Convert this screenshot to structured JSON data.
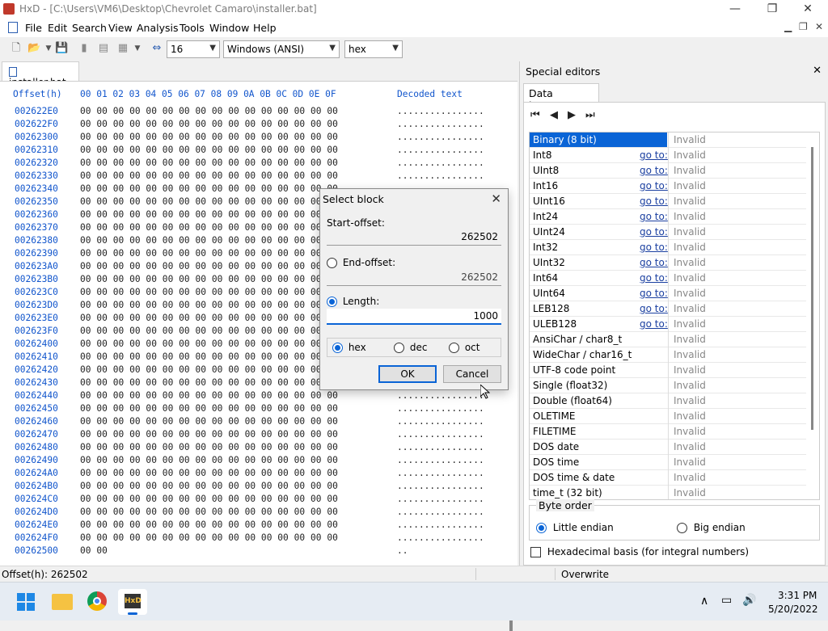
{
  "window": {
    "title": "HxD - [C:\\Users\\VM6\\Desktop\\Chevrolet Camaro\\installer.bat]",
    "minimize": "—",
    "maximize": "❐",
    "close": "✕"
  },
  "menu": [
    "File",
    "Edit",
    "Search",
    "View",
    "Analysis",
    "Tools",
    "Window",
    "Help"
  ],
  "toolbar": {
    "bytes_per_row": "16",
    "charset": "Windows (ANSI)",
    "display_mode": "hex"
  },
  "editor": {
    "tab": "installer.bat",
    "header_offset": "Offset(h)",
    "header_bytes": "00 01 02 03 04 05 06 07 08 09 0A 0B 0C 0D 0E 0F",
    "header_decoded": "Decoded text",
    "rows": [
      {
        "o": "002622E0",
        "h": "00 00 00 00 00 00 00 00 00 00 00 00 00 00 00 00",
        "d": "................"
      },
      {
        "o": "002622F0",
        "h": "00 00 00 00 00 00 00 00 00 00 00 00 00 00 00 00",
        "d": "................"
      },
      {
        "o": "00262300",
        "h": "00 00 00 00 00 00 00 00 00 00 00 00 00 00 00 00",
        "d": "................"
      },
      {
        "o": "00262310",
        "h": "00 00 00 00 00 00 00 00 00 00 00 00 00 00 00 00",
        "d": "................"
      },
      {
        "o": "00262320",
        "h": "00 00 00 00 00 00 00 00 00 00 00 00 00 00 00 00",
        "d": "................"
      },
      {
        "o": "00262330",
        "h": "00 00 00 00 00 00 00 00 00 00 00 00 00 00 00 00",
        "d": "................"
      },
      {
        "o": "00262340",
        "h": "00 00 00 00 00 00 00 00 00 00 00 00 00 00 00 00",
        "d": "................"
      },
      {
        "o": "00262350",
        "h": "00 00 00 00 00 00 00 00 00 00 00 00 00 00 00 00",
        "d": "................"
      },
      {
        "o": "00262360",
        "h": "00 00 00 00 00 00 00 00 00 00 00 00 00 00 00 00",
        "d": "................"
      },
      {
        "o": "00262370",
        "h": "00 00 00 00 00 00 00 00 00 00 00 00 00 00 00 00",
        "d": "................"
      },
      {
        "o": "00262380",
        "h": "00 00 00 00 00 00 00 00 00 00 00 00 00 00 00 00",
        "d": "................"
      },
      {
        "o": "00262390",
        "h": "00 00 00 00 00 00 00 00 00 00 00 00 00 00 00 00",
        "d": "................"
      },
      {
        "o": "002623A0",
        "h": "00 00 00 00 00 00 00 00 00 00 00 00 00 00 00 00",
        "d": "................"
      },
      {
        "o": "002623B0",
        "h": "00 00 00 00 00 00 00 00 00 00 00 00 00 00 00 00",
        "d": "................"
      },
      {
        "o": "002623C0",
        "h": "00 00 00 00 00 00 00 00 00 00 00 00 00 00 00 00",
        "d": "................"
      },
      {
        "o": "002623D0",
        "h": "00 00 00 00 00 00 00 00 00 00 00 00 00 00 00 00",
        "d": "................"
      },
      {
        "o": "002623E0",
        "h": "00 00 00 00 00 00 00 00 00 00 00 00 00 00 00 00",
        "d": "................"
      },
      {
        "o": "002623F0",
        "h": "00 00 00 00 00 00 00 00 00 00 00 00 00 00 00 00",
        "d": "................"
      },
      {
        "o": "00262400",
        "h": "00 00 00 00 00 00 00 00 00 00 00 00 00 00 00 00",
        "d": "................"
      },
      {
        "o": "00262410",
        "h": "00 00 00 00 00 00 00 00 00 00 00 00 00 00 00 00",
        "d": "................"
      },
      {
        "o": "00262420",
        "h": "00 00 00 00 00 00 00 00 00 00 00 00 00 00 00 00",
        "d": "................"
      },
      {
        "o": "00262430",
        "h": "00 00 00 00 00 00 00 00 00 00 00 00 00 00 00 00",
        "d": "................"
      },
      {
        "o": "00262440",
        "h": "00 00 00 00 00 00 00 00 00 00 00 00 00 00 00 00",
        "d": "................"
      },
      {
        "o": "00262450",
        "h": "00 00 00 00 00 00 00 00 00 00 00 00 00 00 00 00",
        "d": "................"
      },
      {
        "o": "00262460",
        "h": "00 00 00 00 00 00 00 00 00 00 00 00 00 00 00 00",
        "d": "................"
      },
      {
        "o": "00262470",
        "h": "00 00 00 00 00 00 00 00 00 00 00 00 00 00 00 00",
        "d": "................"
      },
      {
        "o": "00262480",
        "h": "00 00 00 00 00 00 00 00 00 00 00 00 00 00 00 00",
        "d": "................"
      },
      {
        "o": "00262490",
        "h": "00 00 00 00 00 00 00 00 00 00 00 00 00 00 00 00",
        "d": "................"
      },
      {
        "o": "002624A0",
        "h": "00 00 00 00 00 00 00 00 00 00 00 00 00 00 00 00",
        "d": "................"
      },
      {
        "o": "002624B0",
        "h": "00 00 00 00 00 00 00 00 00 00 00 00 00 00 00 00",
        "d": "................"
      },
      {
        "o": "002624C0",
        "h": "00 00 00 00 00 00 00 00 00 00 00 00 00 00 00 00",
        "d": "................"
      },
      {
        "o": "002624D0",
        "h": "00 00 00 00 00 00 00 00 00 00 00 00 00 00 00 00",
        "d": "................"
      },
      {
        "o": "002624E0",
        "h": "00 00 00 00 00 00 00 00 00 00 00 00 00 00 00 00",
        "d": "................"
      },
      {
        "o": "002624F0",
        "h": "00 00 00 00 00 00 00 00 00 00 00 00 00 00 00 00",
        "d": "................"
      },
      {
        "o": "00262500",
        "h": "00 00",
        "d": ".."
      }
    ]
  },
  "special": {
    "title": "Special editors",
    "close": "✕",
    "inspector_tab": "Data inspector",
    "nav": [
      "⏮",
      "◀",
      "▶",
      "⏭"
    ],
    "rows": [
      {
        "name": "Binary (8 bit)",
        "goto": "",
        "value": "Invalid"
      },
      {
        "name": "Int8",
        "goto": "go to:",
        "value": "Invalid"
      },
      {
        "name": "UInt8",
        "goto": "go to:",
        "value": "Invalid"
      },
      {
        "name": "Int16",
        "goto": "go to:",
        "value": "Invalid"
      },
      {
        "name": "UInt16",
        "goto": "go to:",
        "value": "Invalid"
      },
      {
        "name": "Int24",
        "goto": "go to:",
        "value": "Invalid"
      },
      {
        "name": "UInt24",
        "goto": "go to:",
        "value": "Invalid"
      },
      {
        "name": "Int32",
        "goto": "go to:",
        "value": "Invalid"
      },
      {
        "name": "UInt32",
        "goto": "go to:",
        "value": "Invalid"
      },
      {
        "name": "Int64",
        "goto": "go to:",
        "value": "Invalid"
      },
      {
        "name": "UInt64",
        "goto": "go to:",
        "value": "Invalid"
      },
      {
        "name": "LEB128",
        "goto": "go to:",
        "value": "Invalid"
      },
      {
        "name": "ULEB128",
        "goto": "go to:",
        "value": "Invalid"
      },
      {
        "name": "AnsiChar / char8_t",
        "goto": "",
        "value": "Invalid"
      },
      {
        "name": "WideChar / char16_t",
        "goto": "",
        "value": "Invalid"
      },
      {
        "name": "UTF-8 code point",
        "goto": "",
        "value": "Invalid"
      },
      {
        "name": "Single (float32)",
        "goto": "",
        "value": "Invalid"
      },
      {
        "name": "Double (float64)",
        "goto": "",
        "value": "Invalid"
      },
      {
        "name": "OLETIME",
        "goto": "",
        "value": "Invalid"
      },
      {
        "name": "FILETIME",
        "goto": "",
        "value": "Invalid"
      },
      {
        "name": "DOS date",
        "goto": "",
        "value": "Invalid"
      },
      {
        "name": "DOS time",
        "goto": "",
        "value": "Invalid"
      },
      {
        "name": "DOS time & date",
        "goto": "",
        "value": "Invalid"
      },
      {
        "name": "time_t (32 bit)",
        "goto": "",
        "value": "Invalid"
      }
    ],
    "byte_order_label": "Byte order",
    "little_endian": "Little endian",
    "big_endian": "Big endian",
    "hex_basis": "Hexadecimal basis (for integral numbers)"
  },
  "status": {
    "offset": "Offset(h): 262502",
    "mode": "Overwrite"
  },
  "dialog": {
    "title": "Select block",
    "close": "✕",
    "start_label": "Start-offset:",
    "start_value": "262502",
    "end_label": "End-offset:",
    "end_value": "262502",
    "length_label": "Length:",
    "length_value": "1000",
    "radix": [
      "hex",
      "dec",
      "oct"
    ],
    "ok": "OK",
    "cancel": "Cancel"
  },
  "taskbar": {
    "time": "3:31 PM",
    "date": "5/20/2022"
  },
  "colors": {
    "accent": "#0a64d6",
    "offset_blue": "#1155cc"
  }
}
